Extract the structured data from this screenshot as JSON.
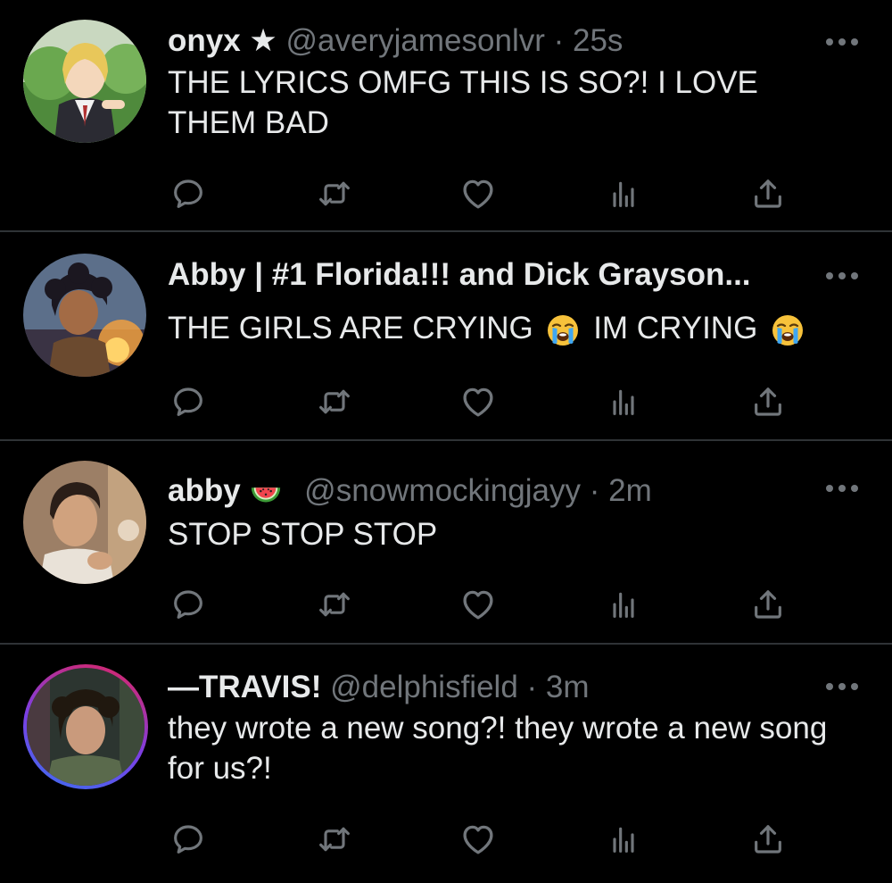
{
  "colors": {
    "background": "#000000",
    "divider": "#2f3336",
    "text": "#e7e9ea",
    "muted": "#71767b"
  },
  "tweets": [
    {
      "name": "onyx ★",
      "handle": "@averyjamesonlvr",
      "separator": "·",
      "time": "25s",
      "text": "THE LYRICS OMFG THIS IS SO?! I LOVE THEM BAD"
    },
    {
      "name": "Abby | #1 Florida!!! and Dick Grayson...",
      "text_part1": "THE GIRLS ARE CRYING",
      "text_part2": "IM CRYING",
      "emoji": "loudly-crying-face"
    },
    {
      "name": "abby",
      "name_emoji": "watermelon",
      "handle": "@snowmockingjayy",
      "separator": "·",
      "time": "2m",
      "text": "STOP STOP STOP"
    },
    {
      "name": "—TRAVIS!",
      "handle": "@delphisfield",
      "separator": "·",
      "time": "3m",
      "text": "they wrote a new song?! they wrote a new song for us?!"
    }
  ],
  "action_icons": [
    "reply-icon",
    "retweet-icon",
    "like-icon",
    "analytics-icon",
    "share-icon"
  ]
}
